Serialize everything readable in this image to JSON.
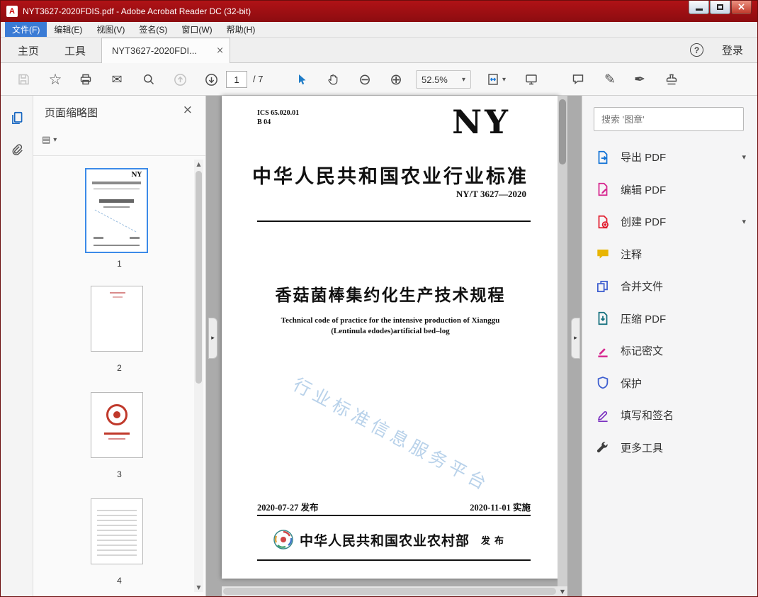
{
  "window": {
    "title": "NYT3627-2020FDIS.pdf - Adobe Acrobat Reader DC (32-bit)",
    "app_icon_letter": "A"
  },
  "menu": {
    "items": [
      {
        "label": "文件(F)",
        "active": true
      },
      {
        "label": "编辑(E)"
      },
      {
        "label": "视图(V)"
      },
      {
        "label": "签名(S)"
      },
      {
        "label": "窗口(W)"
      },
      {
        "label": "帮助(H)"
      }
    ]
  },
  "tabbar": {
    "home": "主页",
    "tools": "工具",
    "document_tab": "NYT3627-2020FDI...",
    "signin": "登录"
  },
  "toolbar": {
    "page_current": "1",
    "page_total": "/ 7",
    "zoom_level": "52.5%"
  },
  "thumbnails_panel": {
    "title": "页面缩略图",
    "pages": [
      {
        "num": "1",
        "selected": true
      },
      {
        "num": "2"
      },
      {
        "num": "3"
      },
      {
        "num": "4"
      }
    ]
  },
  "document": {
    "ics_line1": "ICS 65.020.01",
    "ics_line2": "B 04",
    "logo": "NY",
    "standard_heading": "中华人民共和国农业行业标准",
    "standard_number": "NY/T 3627—2020",
    "title_cn": "香菇菌棒集约化生产技术规程",
    "title_en_line1": "Technical code of practice for the intensive production of Xianggu",
    "title_en_line2": "(Lentinula edodes)artificial bed–log",
    "watermark": "行业标准信息服务平台",
    "issue_date": "2020-07-27 发布",
    "implement_date": "2020-11-01 实施",
    "issuer": "中华人民共和国农业农村部",
    "issuer_suffix": "发布"
  },
  "tools_panel": {
    "search_placeholder": "搜索 '图章'",
    "items": [
      {
        "label": "导出 PDF",
        "icon": "export-pdf-icon",
        "color": "#1373d6",
        "chevron": true
      },
      {
        "label": "编辑 PDF",
        "icon": "edit-pdf-icon",
        "color": "#d6258e"
      },
      {
        "label": "创建 PDF",
        "icon": "create-pdf-icon",
        "color": "#e11d2e",
        "chevron": true
      },
      {
        "label": "注释",
        "icon": "comment-icon",
        "color": "#e8b503"
      },
      {
        "label": "合并文件",
        "icon": "combine-files-icon",
        "color": "#3f5fd0"
      },
      {
        "label": "压缩 PDF",
        "icon": "compress-pdf-icon",
        "color": "#14707e"
      },
      {
        "label": "标记密文",
        "icon": "redact-icon",
        "color": "#d6258e"
      },
      {
        "label": "保护",
        "icon": "protect-icon",
        "color": "#3f5fd0"
      },
      {
        "label": "填写和签名",
        "icon": "fill-sign-icon",
        "color": "#7a2fc0"
      },
      {
        "label": "更多工具",
        "icon": "more-tools-icon",
        "color": "#3d3d3d"
      }
    ]
  },
  "icons": {
    "star": "☆",
    "envelope": "✉",
    "zoom_out": "⊖",
    "zoom_in": "⊕",
    "caret_down": "▾",
    "close": "×",
    "help": "?",
    "up_arrow": "▲",
    "down_arrow": "▼",
    "collapse": "▸",
    "pencil": "✎",
    "pen_nib": "✒",
    "list": "▤"
  },
  "colors": {
    "titlebar": "#9c1212",
    "menu_highlight": "#3a7bd5",
    "accent_blue": "#1f7cc7",
    "selection_border": "#3c8ae8",
    "canvas_gray": "#ababab",
    "watermark_blue": "#b9d2ea"
  }
}
